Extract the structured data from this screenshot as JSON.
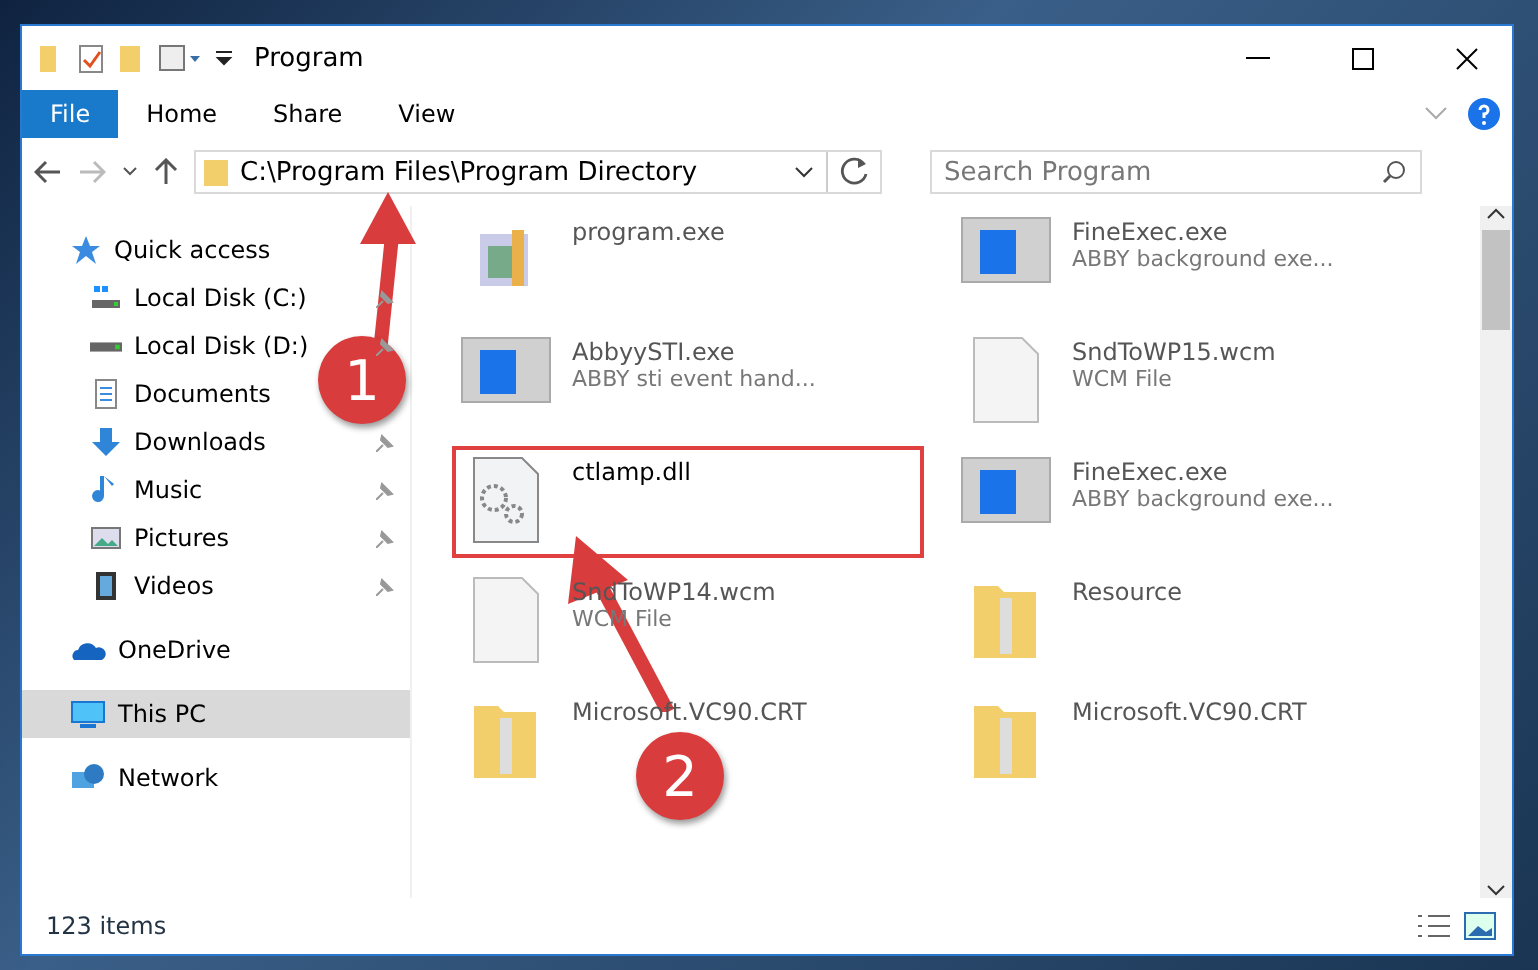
{
  "window": {
    "title": "Program"
  },
  "ribbon_tabs": [
    {
      "label": "File",
      "selected": true
    },
    {
      "label": "Home",
      "selected": false
    },
    {
      "label": "Share",
      "selected": false
    },
    {
      "label": "View",
      "selected": false
    }
  ],
  "address": {
    "path": "C:\\Program Files\\Program Directory"
  },
  "search": {
    "placeholder": "Search Program"
  },
  "sidebar": {
    "items": [
      {
        "label": "Quick access",
        "kind": "quick",
        "selected": false,
        "pinned": false
      },
      {
        "label": "Local Disk (C:)",
        "kind": "disk-c",
        "selected": false,
        "pinned": true
      },
      {
        "label": "Local Disk (D:)",
        "kind": "disk",
        "selected": false,
        "pinned": true
      },
      {
        "label": "Documents",
        "kind": "docs",
        "selected": false,
        "pinned": false
      },
      {
        "label": "Downloads",
        "kind": "downloads",
        "selected": false,
        "pinned": true
      },
      {
        "label": "Music",
        "kind": "music",
        "selected": false,
        "pinned": true
      },
      {
        "label": "Pictures",
        "kind": "pictures",
        "selected": false,
        "pinned": true
      },
      {
        "label": "Videos",
        "kind": "videos",
        "selected": false,
        "pinned": true
      },
      {
        "label": "OneDrive",
        "kind": "cloud",
        "selected": false,
        "pinned": false
      },
      {
        "label": "This PC",
        "kind": "pc",
        "selected": true,
        "pinned": false
      },
      {
        "label": "Network",
        "kind": "network",
        "selected": false,
        "pinned": false
      }
    ]
  },
  "files": [
    {
      "name": "program.exe",
      "kind": "setup",
      "marked": false
    },
    {
      "name": "FineExec.exe",
      "detail": "ABBY background exe...",
      "kind": "app",
      "marked": false
    },
    {
      "name": "AbbyySTI.exe",
      "detail": "ABBY sti event hand...",
      "kind": "app",
      "marked": false
    },
    {
      "name": "SndToWP15.wcm",
      "detail": "WCM File",
      "kind": "file",
      "marked": false
    },
    {
      "name": "ctlamp.dll",
      "kind": "dll",
      "marked": true
    },
    {
      "name": "FineExec.exe",
      "detail": "ABBY background exe...",
      "kind": "app",
      "marked": false
    },
    {
      "name": "SndToWP14.wcm",
      "detail": "WCM File",
      "kind": "file",
      "marked": false
    },
    {
      "name": "Resource",
      "kind": "folder",
      "marked": false
    },
    {
      "name": "Microsoft.VC90.CRT",
      "kind": "folder",
      "marked": false
    },
    {
      "name": "Microsoft.VC90.CRT",
      "kind": "folder",
      "marked": false
    }
  ],
  "status_bar": {
    "count": "123 items"
  },
  "annotations": [
    {
      "number": "1"
    },
    {
      "number": "2"
    }
  ]
}
